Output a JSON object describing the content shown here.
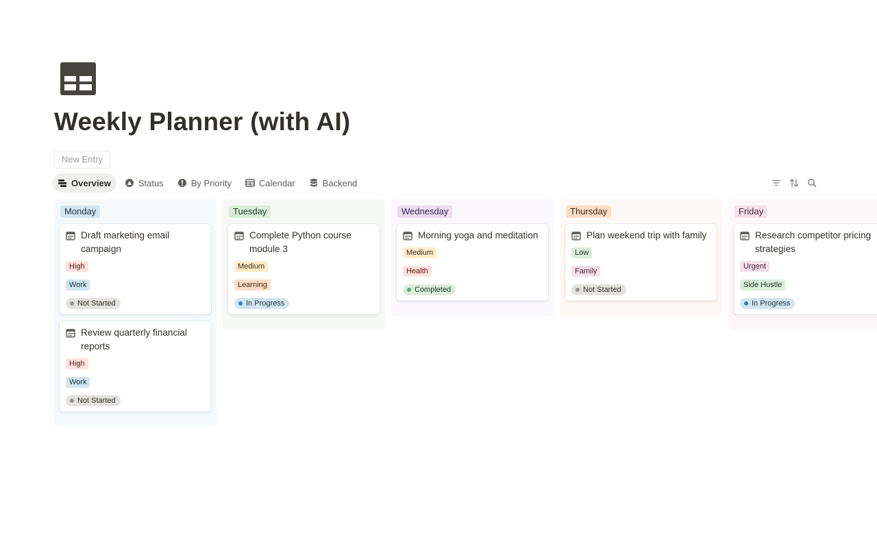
{
  "page": {
    "title": "Weekly Planner (with AI)",
    "icon": "table-icon",
    "new_entry_label": "New Entry"
  },
  "tabs": [
    {
      "label": "Overview",
      "icon": "board-icon",
      "active": true
    },
    {
      "label": "Status",
      "icon": "status-icon",
      "active": false
    },
    {
      "label": "By Priority",
      "icon": "priority-icon",
      "active": false
    },
    {
      "label": "Calendar",
      "icon": "calendar-table-icon",
      "active": false
    },
    {
      "label": "Backend",
      "icon": "database-icon",
      "active": false
    }
  ],
  "toolbar": {
    "icons": [
      "filter-icon",
      "sort-icon",
      "search-icon"
    ]
  },
  "colors": {
    "monday_bg": "#f4f9fc",
    "monday_label_bg": "#d3e5ef",
    "monday_label_fg": "#183347",
    "tuesday_bg": "#f6f8f6",
    "tuesday_label_bg": "#dbeddb",
    "tuesday_label_fg": "#1c3829",
    "wednesday_bg": "#faf7fd",
    "wednesday_label_bg": "#e8deee",
    "wednesday_label_fg": "#412454",
    "thursday_bg": "#fdf8f5",
    "thursday_label_bg": "#fadec9",
    "thursday_label_fg": "#49290e",
    "friday_bg": "#fdf7f9",
    "friday_label_bg": "#f5e0e9",
    "friday_label_fg": "#4c2337"
  },
  "board": {
    "columns": [
      {
        "label": "Monday",
        "cards": [
          {
            "title": "Draft marketing email campaign",
            "priority": "High",
            "category": "Work",
            "status": "Not Started"
          },
          {
            "title": "Review quarterly financial reports",
            "priority": "High",
            "category": "Work",
            "status": "Not Started"
          }
        ]
      },
      {
        "label": "Tuesday",
        "cards": [
          {
            "title": "Complete Python course module 3",
            "priority": "Medium",
            "category": "Learning",
            "status": "In Progress"
          }
        ]
      },
      {
        "label": "Wednesday",
        "cards": [
          {
            "title": "Morning yoga and meditation",
            "priority": "Medium",
            "category": "Health",
            "status": "Completed"
          }
        ]
      },
      {
        "label": "Thursday",
        "cards": [
          {
            "title": "Plan weekend trip with family",
            "priority": "Low",
            "category": "Family",
            "status": "Not Started"
          }
        ]
      },
      {
        "label": "Friday",
        "cards": [
          {
            "title": "Research competitor pricing strategies",
            "priority": "Urgent",
            "category": "Side Hustle",
            "status": "In Progress"
          }
        ]
      }
    ]
  }
}
